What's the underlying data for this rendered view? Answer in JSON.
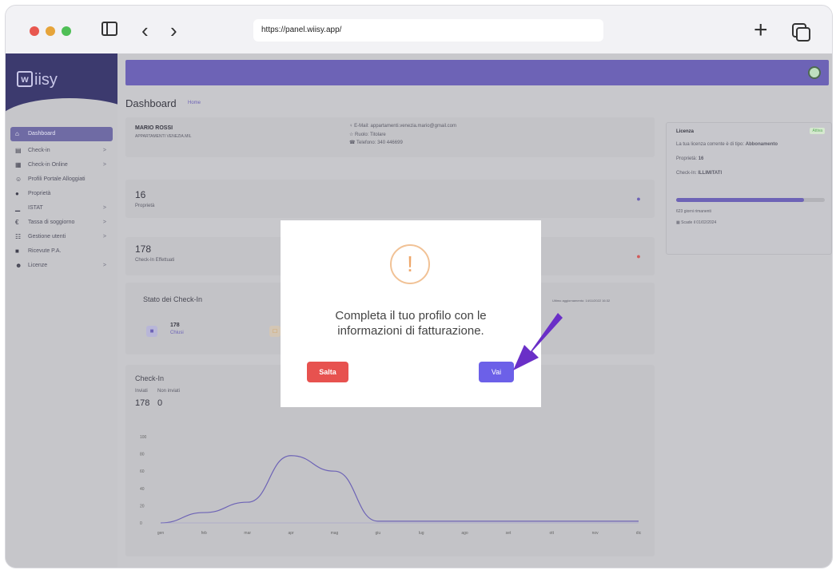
{
  "browser": {
    "url": "https://panel.wiisy.app/"
  },
  "logo": {
    "text": "iisy"
  },
  "sidebar": {
    "items": [
      {
        "label": "Dashboard",
        "icon": "home-icon",
        "chevron": ""
      },
      {
        "label": "Check-in",
        "icon": "book-icon",
        "chevron": ">"
      },
      {
        "label": "Check-in Online",
        "icon": "calendar-icon",
        "chevron": ">"
      },
      {
        "label": "Profili Portale Alloggiati",
        "icon": "users-icon",
        "chevron": ""
      },
      {
        "label": "Proprietà",
        "icon": "pin-icon",
        "chevron": ""
      },
      {
        "label": "ISTAT",
        "icon": "chart-icon",
        "chevron": ">"
      },
      {
        "label": "Tassa di soggiorno",
        "icon": "euro-icon",
        "chevron": ">"
      },
      {
        "label": "Gestione utenti",
        "icon": "group-icon",
        "chevron": ">"
      },
      {
        "label": "Ricevute P.A.",
        "icon": "receipt-icon",
        "chevron": ""
      },
      {
        "label": "Licenze",
        "icon": "license-icon",
        "chevron": ">"
      }
    ]
  },
  "page": {
    "title": "Dashboard",
    "breadcrumb": "Home"
  },
  "profile": {
    "name": "MARIO ROSSI",
    "company": "APPARTAMENTI VENEZIA.MIL",
    "email_label": "E-Mail:",
    "email": "appartamenti.venezia.mario@gmail.com",
    "role_label": "Ruolo:",
    "role": "Titolare",
    "phone_label": "Telefono:",
    "phone": "340 446699"
  },
  "stats": {
    "properties_value": "16",
    "properties_label": "Proprietà",
    "checkins_value": "178",
    "checkins_label": "Check-In Effettuati"
  },
  "stato": {
    "title": "Stato dei Check-In",
    "updated": "Ultimo aggiornamento: 14/11/2022 16:32",
    "closed_value": "178",
    "closed_label": "Chiusi"
  },
  "license": {
    "title": "Licenza",
    "badge": "Attiva",
    "type_prefix": "La tua licenza corrente è di tipo:",
    "type": "Abbonamento",
    "properties_prefix": "Proprietà:",
    "properties": "16",
    "checkin_prefix": "Check-In:",
    "checkin": "ILLIMITATI",
    "remaining": "623 giorni rimanenti",
    "expiry": "Scade il 01/02/2024",
    "progress": 0.86
  },
  "chart_data": {
    "type": "line",
    "title": "Check-In",
    "legend": [
      "Inviati",
      "Non inviati"
    ],
    "totals": [
      "178",
      "0"
    ],
    "categories": [
      "gen",
      "feb",
      "mar",
      "apr",
      "mag",
      "giu",
      "lug",
      "ago",
      "set",
      "ott",
      "nov",
      "dic"
    ],
    "yticks": [
      "100",
      "80",
      "60",
      "40",
      "20",
      "0"
    ],
    "ylim": [
      0,
      100
    ],
    "series": [
      {
        "name": "Inviati",
        "values": [
          0,
          12,
          24,
          78,
          60,
          2,
          2,
          2,
          2,
          2,
          2,
          2
        ]
      },
      {
        "name": "Non inviati",
        "values": [
          0,
          0,
          0,
          0,
          0,
          0,
          0,
          0,
          0,
          0,
          0,
          0
        ]
      }
    ],
    "color": "#6d63b6"
  },
  "modal": {
    "icon": "!",
    "message_line1": "Completa il tuo profilo con le",
    "message_line2": "informazioni di fatturazione.",
    "skip_label": "Salta",
    "go_label": "Vai"
  }
}
